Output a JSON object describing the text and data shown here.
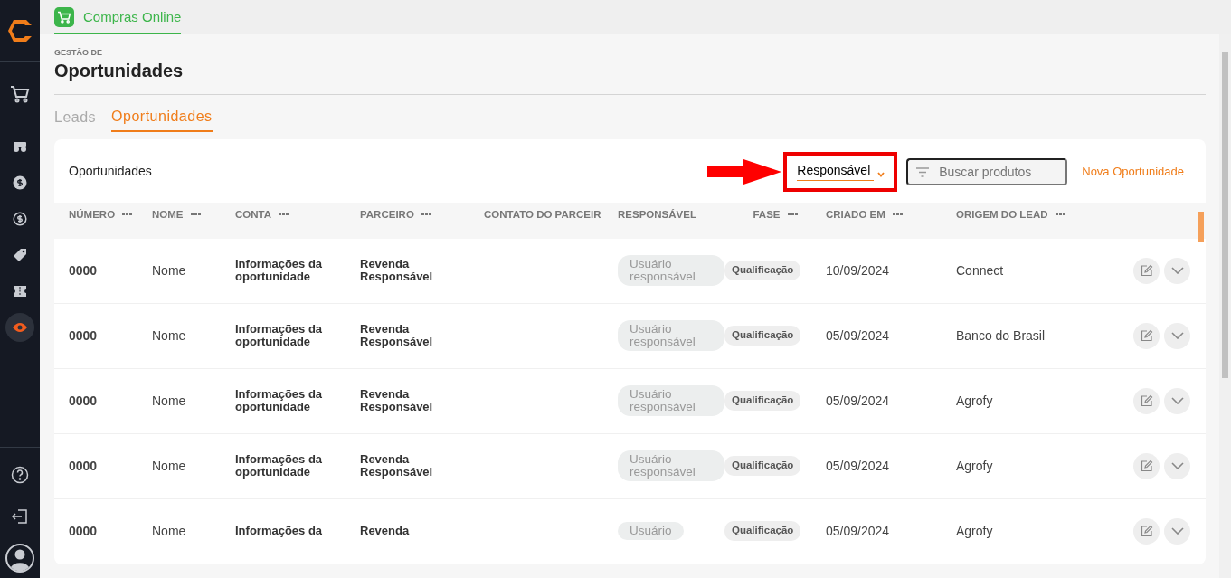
{
  "app_tab": {
    "label": "Compras Online",
    "selected": true
  },
  "sidebar": {
    "items": [
      {
        "kind": "cart",
        "selected": false
      },
      {
        "kind": "tractor",
        "selected": false
      },
      {
        "kind": "dollar",
        "selected": false
      },
      {
        "kind": "dollar-cycle",
        "selected": false
      },
      {
        "kind": "tag",
        "selected": false
      },
      {
        "kind": "ticket",
        "selected": false
      },
      {
        "kind": "eye",
        "selected": true
      }
    ],
    "footer": [
      {
        "kind": "help"
      },
      {
        "kind": "logout"
      },
      {
        "kind": "avatar"
      }
    ]
  },
  "page": {
    "kicker": "GESTÃO DE",
    "title": "Oportunidades"
  },
  "tabs": [
    {
      "label": "Leads",
      "selected": false
    },
    {
      "label": "Oportunidades",
      "selected": true
    }
  ],
  "card": {
    "title": "Oportunidades",
    "filter_select": {
      "value": "Responsável",
      "highlighted": true
    },
    "search": {
      "placeholder": "Buscar produtos"
    },
    "new_button": "Nova Oportunidade"
  },
  "table": {
    "columns": [
      {
        "label": "NÚMERO",
        "menu": true
      },
      {
        "label": "NOME",
        "menu": true
      },
      {
        "label": "CONTA",
        "menu": true
      },
      {
        "label": "PARCEIRO",
        "menu": true
      },
      {
        "label": "CONTATO DO PARCEIR",
        "menu": false
      },
      {
        "label": "RESPONSÁVEL",
        "menu": false
      },
      {
        "label": "FASE",
        "menu": true
      },
      {
        "label": "CRIADO EM",
        "menu": true
      },
      {
        "label": "ORIGEM DO LEAD",
        "menu": true
      }
    ],
    "rows": [
      {
        "number": "0000",
        "name": "Nome",
        "account": "Informações da oportunidade",
        "partner": "Revenda Responsável",
        "responsible": "Usuário responsável",
        "phase": "Qualificação",
        "created": "10/09/2024",
        "origin": "Connect"
      },
      {
        "number": "0000",
        "name": "Nome",
        "account": "Informações da oportunidade",
        "partner": "Revenda Responsável",
        "responsible": "Usuário responsável",
        "phase": "Qualificação",
        "created": "05/09/2024",
        "origin": "Banco do Brasil"
      },
      {
        "number": "0000",
        "name": "Nome",
        "account": "Informações da oportunidade",
        "partner": "Revenda Responsável",
        "responsible": "Usuário responsável",
        "phase": "Qualificação",
        "created": "05/09/2024",
        "origin": "Agrofy"
      },
      {
        "number": "0000",
        "name": "Nome",
        "account": "Informações da oportunidade",
        "partner": "Revenda Responsável",
        "responsible": "Usuário responsável",
        "phase": "Qualificação",
        "created": "05/09/2024",
        "origin": "Agrofy"
      },
      {
        "number": "0000",
        "name": "Nome",
        "account": "Informações da",
        "partner": "Revenda",
        "responsible": "Usuário",
        "phase": "Qualificação",
        "created": "05/09/2024",
        "origin": "Agrofy"
      }
    ]
  }
}
